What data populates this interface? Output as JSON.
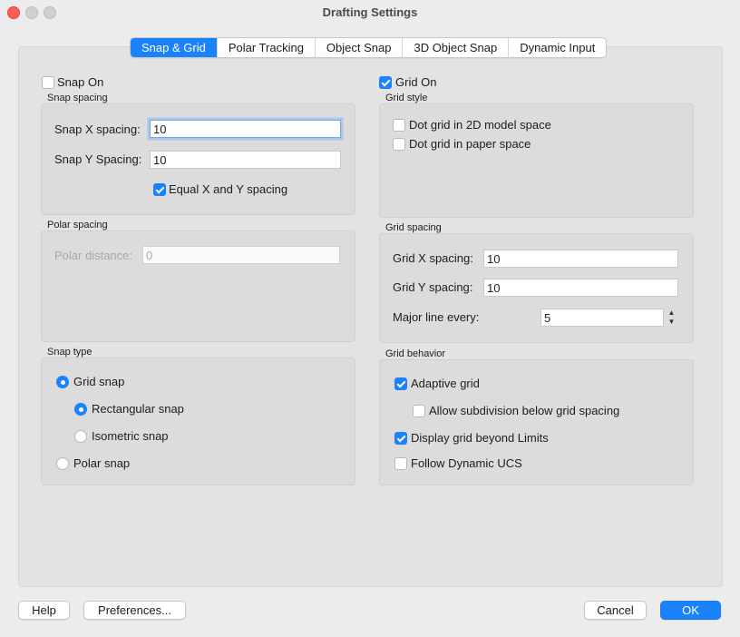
{
  "window": {
    "title": "Drafting Settings"
  },
  "tabs": [
    "Snap & Grid",
    "Polar Tracking",
    "Object Snap",
    "3D Object Snap",
    "Dynamic Input"
  ],
  "snap": {
    "snap_on_label": "Snap On",
    "snap_on_checked": false,
    "spacing_title": "Snap spacing",
    "x_label": "Snap X spacing:",
    "x_value": "10",
    "y_label": "Snap Y Spacing:",
    "y_value": "10",
    "equal_label": "Equal X and Y spacing",
    "equal_checked": true
  },
  "polar": {
    "title": "Polar spacing",
    "distance_label": "Polar distance:",
    "distance_value": "0"
  },
  "snap_type": {
    "title": "Snap type",
    "grid_snap": "Grid snap",
    "rectangular": "Rectangular snap",
    "isometric": "Isometric snap",
    "polar_snap": "Polar snap",
    "selected": "Grid snap",
    "sub_selected": "Rectangular snap"
  },
  "grid": {
    "grid_on_label": "Grid On",
    "grid_on_checked": true,
    "style_title": "Grid style",
    "dot_2d": "Dot grid in 2D model space",
    "dot_paper": "Dot grid in paper space",
    "spacing_title": "Grid spacing",
    "x_label": "Grid X spacing:",
    "x_value": "10",
    "y_label": "Grid Y spacing:",
    "y_value": "10",
    "major_label": "Major line every:",
    "major_value": "5",
    "behavior_title": "Grid behavior",
    "adaptive": "Adaptive grid",
    "adaptive_checked": true,
    "subdivision": "Allow subdivision below grid spacing",
    "subdivision_checked": false,
    "beyond_limits": "Display grid beyond Limits",
    "beyond_limits_checked": true,
    "follow_ucs": "Follow Dynamic UCS",
    "follow_ucs_checked": false
  },
  "buttons": {
    "help": "Help",
    "preferences": "Preferences...",
    "cancel": "Cancel",
    "ok": "OK"
  },
  "colors": {
    "accent": "#1a82fb",
    "close": "#ff5f57"
  }
}
